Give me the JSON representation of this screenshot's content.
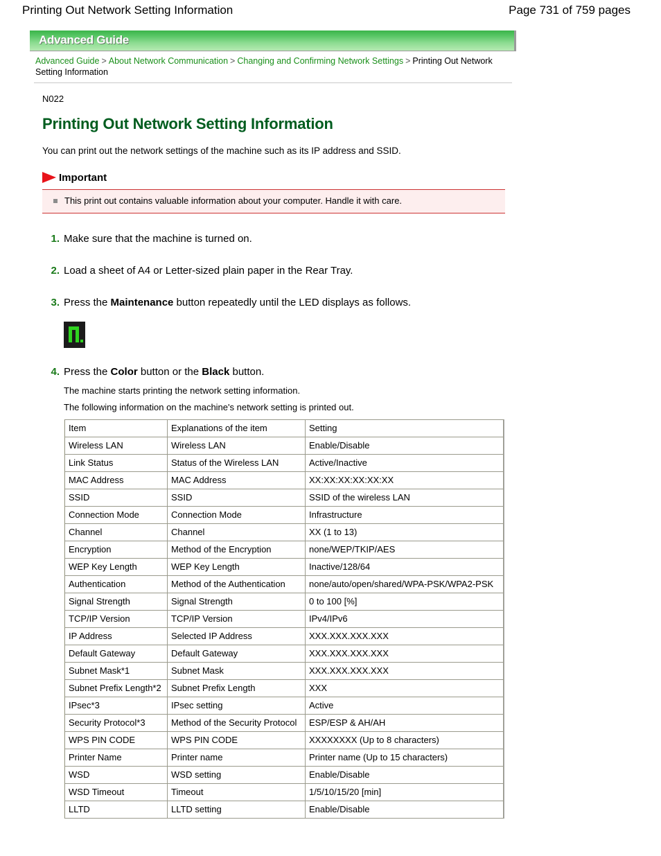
{
  "page_header": {
    "doc_title": "Printing Out Network Setting Information",
    "page_count": "Page 731 of 759 pages"
  },
  "banner": {
    "label": "Advanced Guide"
  },
  "breadcrumb": {
    "items": [
      {
        "label": "Advanced Guide",
        "link": true
      },
      {
        "label": "About Network Communication",
        "link": true
      },
      {
        "label": "Changing and Confirming Network Settings",
        "link": true
      },
      {
        "label": "Printing Out Network Setting Information",
        "link": false
      }
    ],
    "separator": ">"
  },
  "article": {
    "doc_code": "N022",
    "title": "Printing Out Network Setting Information",
    "intro": "You can print out the network settings of the machine such as its IP address and SSID."
  },
  "important": {
    "label": "Important",
    "icon": "red-flag-icon",
    "items": [
      "This print out contains valuable information about your computer. Handle it with care."
    ],
    "background_color": "#fdeeee",
    "border_color": "#cc3333"
  },
  "steps": [
    {
      "num": "1.",
      "text_parts": [
        {
          "t": "Make sure that the machine is turned on.",
          "bold": false
        }
      ]
    },
    {
      "num": "2.",
      "text_parts": [
        {
          "t": "Load a sheet of A4 or Letter-sized plain paper in the Rear Tray.",
          "bold": false
        }
      ]
    },
    {
      "num": "3.",
      "text_parts": [
        {
          "t": "Press the ",
          "bold": false
        },
        {
          "t": "Maintenance",
          "bold": true
        },
        {
          "t": " button repeatedly until the LED displays as follows.",
          "bold": false
        }
      ],
      "led": {
        "icon": "led-seven-segment-n-icon",
        "glyph": "n.",
        "color": "#2fd320",
        "background": "#1b1b1b"
      }
    },
    {
      "num": "4.",
      "text_parts": [
        {
          "t": "Press the ",
          "bold": false
        },
        {
          "t": "Color",
          "bold": true
        },
        {
          "t": " button or the ",
          "bold": false
        },
        {
          "t": "Black",
          "bold": true
        },
        {
          "t": " button.",
          "bold": false
        }
      ],
      "sub_lines": [
        "The machine starts printing the network setting information.",
        "The following information on the machine's network setting is printed out."
      ]
    }
  ],
  "spec_table": {
    "headers": [
      "Item",
      "Explanations of the item",
      "Setting"
    ],
    "rows": [
      [
        "Wireless LAN",
        "Wireless LAN",
        "Enable/Disable"
      ],
      [
        "Link Status",
        "Status of the Wireless LAN",
        "Active/Inactive"
      ],
      [
        "MAC Address",
        "MAC Address",
        "XX:XX:XX:XX:XX:XX"
      ],
      [
        "SSID",
        "SSID",
        "SSID of the wireless LAN"
      ],
      [
        "Connection Mode",
        "Connection Mode",
        "Infrastructure"
      ],
      [
        "Channel",
        "Channel",
        "XX (1 to 13)"
      ],
      [
        "Encryption",
        "Method of the Encryption",
        "none/WEP/TKIP/AES"
      ],
      [
        "WEP Key Length",
        "WEP Key Length",
        "Inactive/128/64"
      ],
      [
        "Authentication",
        "Method of the Authentication",
        "none/auto/open/shared/WPA-PSK/WPA2-PSK"
      ],
      [
        "Signal Strength",
        "Signal Strength",
        "0 to 100 [%]"
      ],
      [
        "TCP/IP Version",
        "TCP/IP Version",
        "IPv4/IPv6"
      ],
      [
        "IP Address",
        "Selected IP Address",
        "XXX.XXX.XXX.XXX"
      ],
      [
        "Default Gateway",
        "Default Gateway",
        "XXX.XXX.XXX.XXX"
      ],
      [
        "Subnet Mask*1",
        "Subnet Mask",
        "XXX.XXX.XXX.XXX"
      ],
      [
        "Subnet Prefix Length*2",
        "Subnet Prefix Length",
        "XXX"
      ],
      [
        "IPsec*3",
        "IPsec setting",
        "Active"
      ],
      [
        "Security Protocol*3",
        "Method of the Security Protocol",
        "ESP/ESP & AH/AH"
      ],
      [
        "WPS PIN CODE",
        "WPS PIN CODE",
        "XXXXXXXX (Up to 8 characters)"
      ],
      [
        "Printer Name",
        "Printer name",
        "Printer name (Up to 15 characters)"
      ],
      [
        "WSD",
        "WSD setting",
        "Enable/Disable"
      ],
      [
        "WSD Timeout",
        "Timeout",
        "1/5/10/15/20 [min]"
      ],
      [
        "LLTD",
        "LLTD setting",
        "Enable/Disable"
      ]
    ]
  },
  "colors": {
    "heading_green": "#005c1e",
    "link_green": "#1a8f1a",
    "step_num_green": "#1a7a1a",
    "banner_green_top": "#3bb44a",
    "banner_green_bottom": "#b6eab2",
    "flag_red": "#e8131a"
  }
}
